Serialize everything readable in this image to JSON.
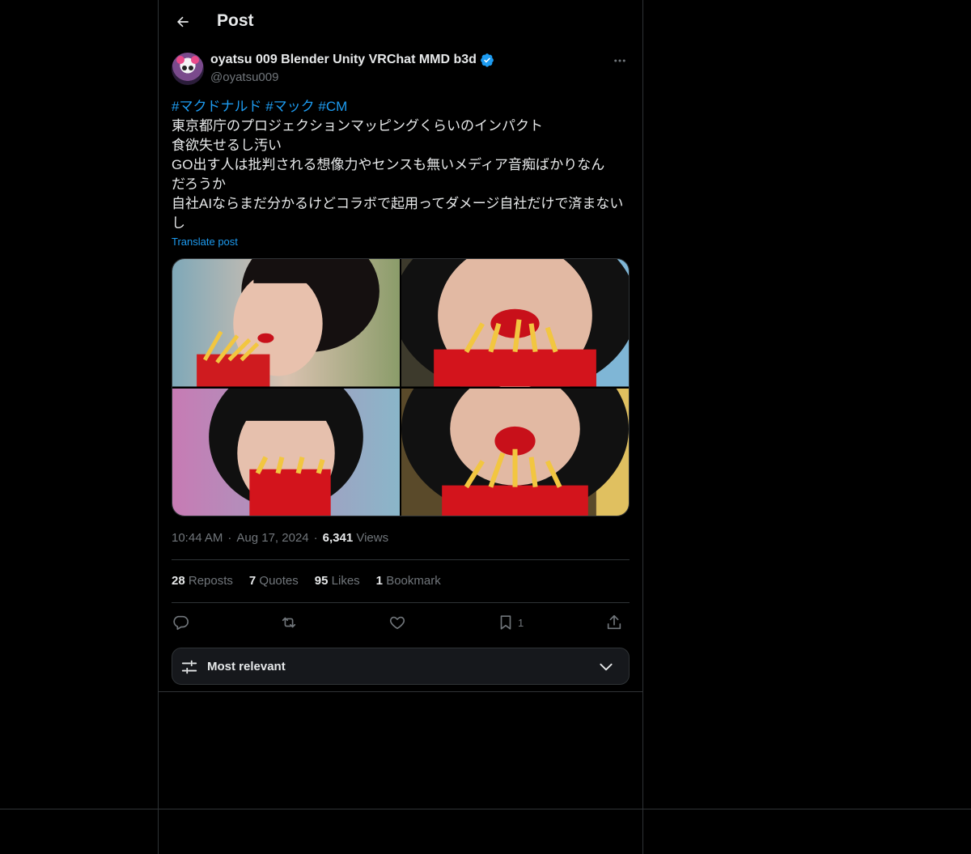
{
  "header": {
    "title": "Post",
    "back_icon": "arrow-left-icon"
  },
  "author": {
    "display_name": "oyatsu 009 Blender Unity VRChat MMD b3d",
    "handle": "@oyatsu009",
    "verified": true
  },
  "post": {
    "hashtags": [
      "#マクドナルド",
      "#マック",
      "#CM"
    ],
    "lines": [
      "東京都庁のプロジェクションマッピングくらいのインパクト",
      "食欲失せるし汚い",
      "GO出す人は批判される想像力やセンスも無いメディア音痴ばかりなんだろうか",
      "自社AIならまだ分かるけどコラボで起用ってダメージ自社だけで済まないし"
    ],
    "translate_label": "Translate post",
    "media_count": 4
  },
  "meta": {
    "time": "10:44 AM",
    "dot": "·",
    "date": "Aug 17, 2024",
    "views_count": "6,341",
    "views_label": "Views"
  },
  "stats": {
    "reposts_count": "28",
    "reposts_label": "Reposts",
    "quotes_count": "7",
    "quotes_label": "Quotes",
    "likes_count": "95",
    "likes_label": "Likes",
    "bookmarks_count": "1",
    "bookmarks_label": "Bookmark"
  },
  "actions": {
    "bookmark_count": "1"
  },
  "sort": {
    "label": "Most relevant"
  },
  "colors": {
    "accent": "#1d9bf0",
    "border": "#2f3336",
    "muted": "#71767b",
    "text": "#e7e9ea"
  }
}
